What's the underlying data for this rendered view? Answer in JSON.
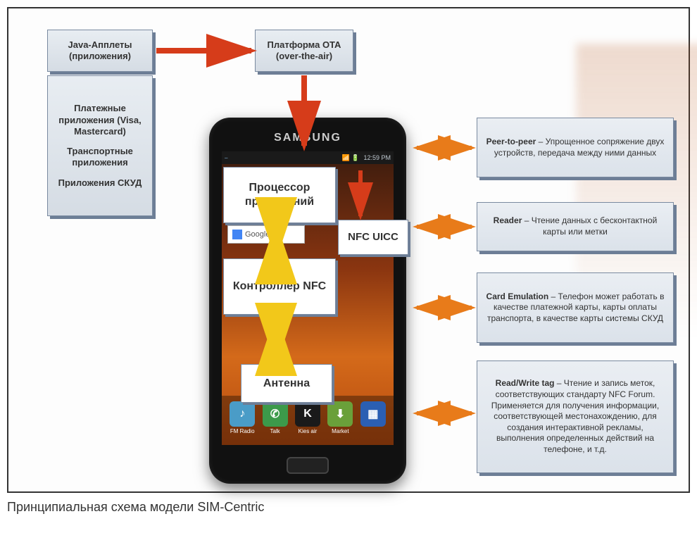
{
  "caption": "Принципиальная схема модели SIM-Centric",
  "left": {
    "java_applets": "Java-Апплеты (приложения)",
    "apps_block": {
      "line1": "Платежные приложения (Visa, Mastercard)",
      "line2": "Транспортные приложения",
      "line3": "Приложения СКУД"
    }
  },
  "ota": {
    "line1": "Платформа OTA",
    "line2": "(over-the-air)"
  },
  "phone": {
    "brand": "SAMSUNG",
    "status_time": "12:59 PM",
    "status_icons": "📶 🔋",
    "google_label": "Google",
    "dock": [
      {
        "label": "FM Radio",
        "color": "#4a9cc7",
        "glyph": "♪"
      },
      {
        "label": "Talk",
        "color": "#3c9a4a",
        "glyph": "✆"
      },
      {
        "label": "Kies air",
        "color": "#1a1a1a",
        "glyph": "K"
      },
      {
        "label": "Market",
        "color": "#6aa03a",
        "glyph": "⬇"
      },
      {
        "label": "",
        "color": "#2b5fb3",
        "glyph": "▦"
      }
    ],
    "overlay": {
      "processor": "Процессор приложений",
      "nfc_uicc": "NFC UICC",
      "controller": "Контроллер NFC",
      "antenna": "Антенна"
    }
  },
  "right": {
    "p2p": {
      "title": "Peer-to-peer",
      "text": " – Упрощенное сопряжение двух устройств, передача между ними данных"
    },
    "reader": {
      "title": "Reader",
      "text": " – Чтение данных с бесконтактной карты или метки"
    },
    "card": {
      "title": "Card Emulation",
      "text": " – Телефон может работать в качестве платежной карты, карты оплаты транспорта, в качестве карты системы СКУД"
    },
    "rw": {
      "title": "Read/Write tag",
      "text": " – Чтение и запись меток, соответствующих стандарту NFC Forum. Применяется для получения информации, соответствующей местонахождению, для создания интерактивной рекламы, выполнения определенных действий на телефоне, и т.д."
    }
  }
}
